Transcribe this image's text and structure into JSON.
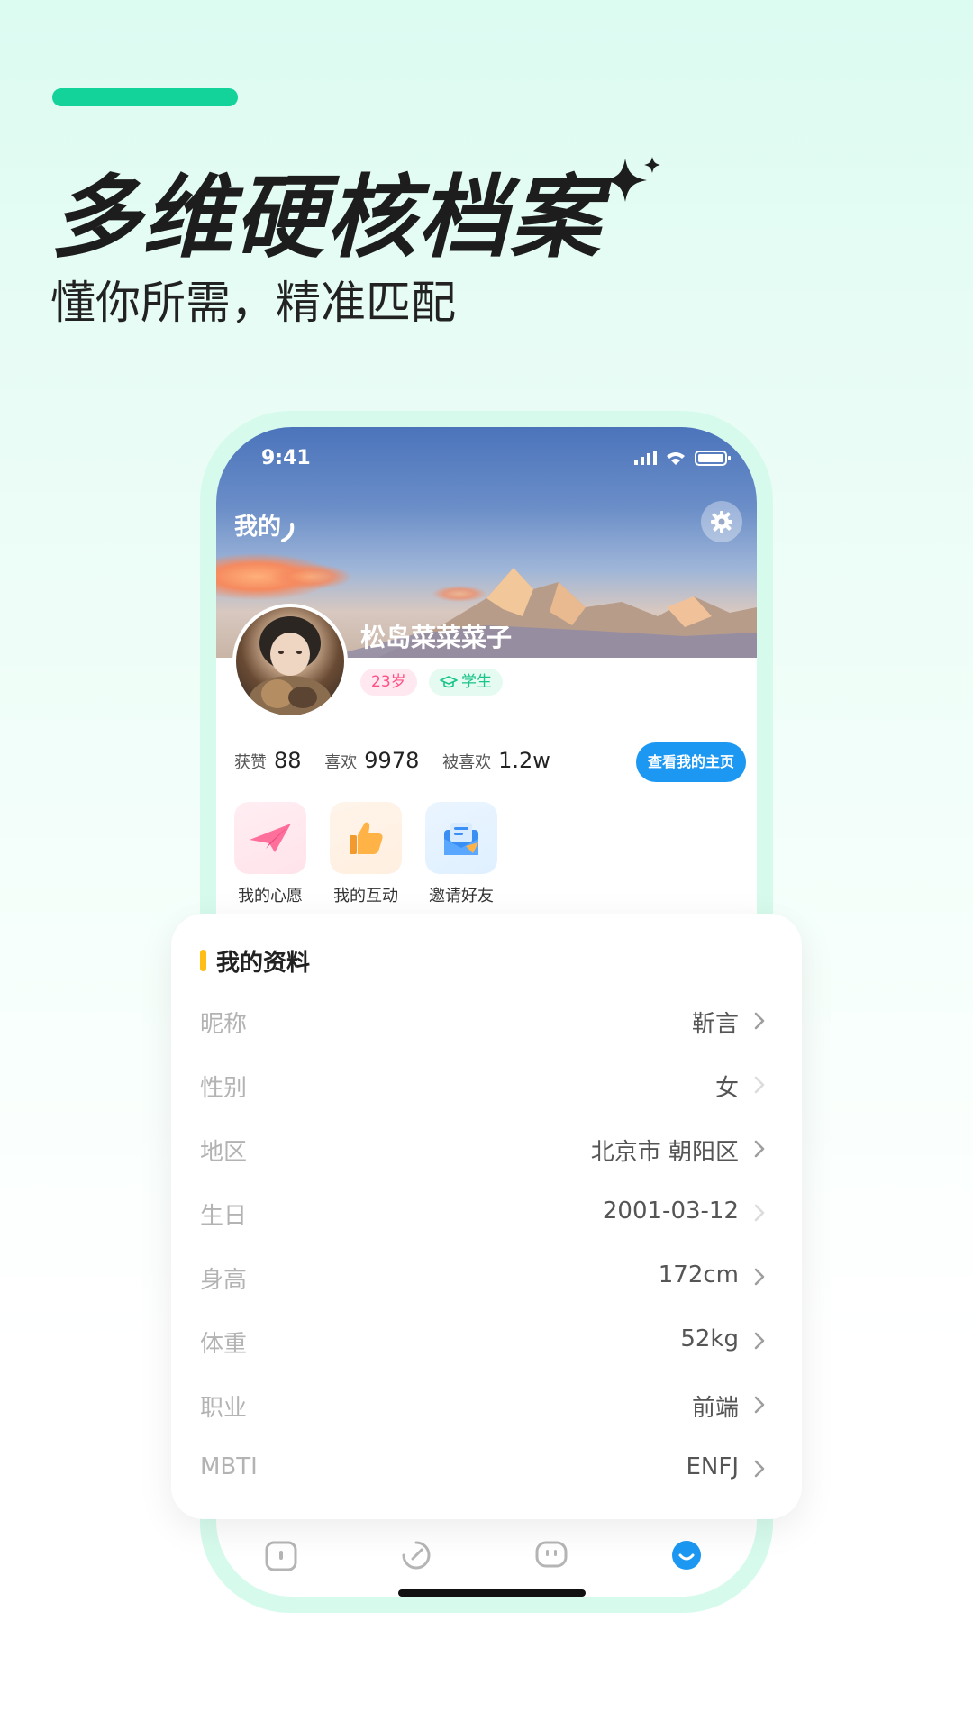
{
  "promo": {
    "headline": "多维硬核档案",
    "subheadline": "懂你所需，精准匹配"
  },
  "status_bar": {
    "time": "9:41"
  },
  "header": {
    "title": "我的"
  },
  "profile": {
    "name": "松岛菜菜菜子",
    "age_tag": "23岁",
    "role_tag": "学生"
  },
  "stats": {
    "likes_label": "获赞",
    "likes_value": "88",
    "liked_label": "喜欢",
    "liked_value": "9978",
    "liked_by_label": "被喜欢",
    "liked_by_value": "1.2w",
    "view_home_label": "查看我的主页"
  },
  "quick_actions": [
    {
      "label": "我的心愿",
      "icon": "paper-plane-icon"
    },
    {
      "label": "我的互动",
      "icon": "thumbs-up-icon"
    },
    {
      "label": "邀请好友",
      "icon": "envelope-icon"
    }
  ],
  "profile_card": {
    "title": "我的资料",
    "rows": [
      {
        "label": "昵称",
        "value": "靳言"
      },
      {
        "label": "性别",
        "value": "女"
      },
      {
        "label": "地区",
        "value": "北京市 朝阳区"
      },
      {
        "label": "生日",
        "value": "2001-03-12"
      },
      {
        "label": "身高",
        "value": "172cm"
      },
      {
        "label": "体重",
        "value": "52kg"
      },
      {
        "label": "职业",
        "value": "前端"
      },
      {
        "label": "MBTI",
        "value": "ENFJ"
      }
    ]
  },
  "colors": {
    "accent_green": "#14d39a",
    "primary_blue": "#1c98f2",
    "age_tag": "#ff4f86",
    "role_tag": "#1ac48a",
    "title_bar": "#ffbe16"
  }
}
